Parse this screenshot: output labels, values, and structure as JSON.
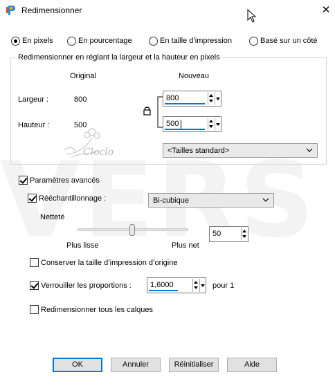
{
  "window": {
    "title": "Redimensionner",
    "close_glyph": "✕"
  },
  "mode": {
    "options": [
      {
        "label": "En pixels",
        "selected": true
      },
      {
        "label": "En pourcentage",
        "selected": false
      },
      {
        "label": "En taille d’impression",
        "selected": false
      },
      {
        "label": "Basé sur un côté",
        "selected": false
      }
    ]
  },
  "group": {
    "title": "Redimensionner en réglant la largeur et la hauteur en pixels",
    "col_original": "Original",
    "col_new": "Nouveau",
    "width_label": "Largeur :",
    "height_label": "Hauteur :",
    "width_original": "800",
    "height_original": "500",
    "width_new": "800",
    "height_new": "500",
    "lock_icon": "lock-icon",
    "preset": "<Tailles standard>"
  },
  "advanced": {
    "label": "Paramètres avancés",
    "checked": true,
    "resample_label": "Rééchantillonnage :",
    "resample_checked": true,
    "resample_value": "Bi-cubique",
    "sharpness_label": "Netteté",
    "smoother_label": "Plus lisse",
    "sharper_label": "Plus net",
    "sharpness_value": "50",
    "keep_print_label": "Conserver la taille d’impression d’origine",
    "keep_print_checked": false,
    "lock_ratio_label": "Verrouiller les proportions :",
    "lock_ratio_checked": true,
    "ratio_value": "1,6000",
    "ratio_suffix": "pour 1",
    "all_layers_label": "Redimensionner tous les calques",
    "all_layers_checked": false
  },
  "buttons": {
    "ok": "OK",
    "cancel": "Annuler",
    "reset": "Réinitialiser",
    "help": "Aide"
  },
  "watermark": {
    "logo_text": "Cloclo",
    "background_text": "VERS"
  },
  "colors": {
    "accent": "#0078d7",
    "button_bg": "#e1e1e1",
    "combo_bg": "#e9e9e9"
  }
}
